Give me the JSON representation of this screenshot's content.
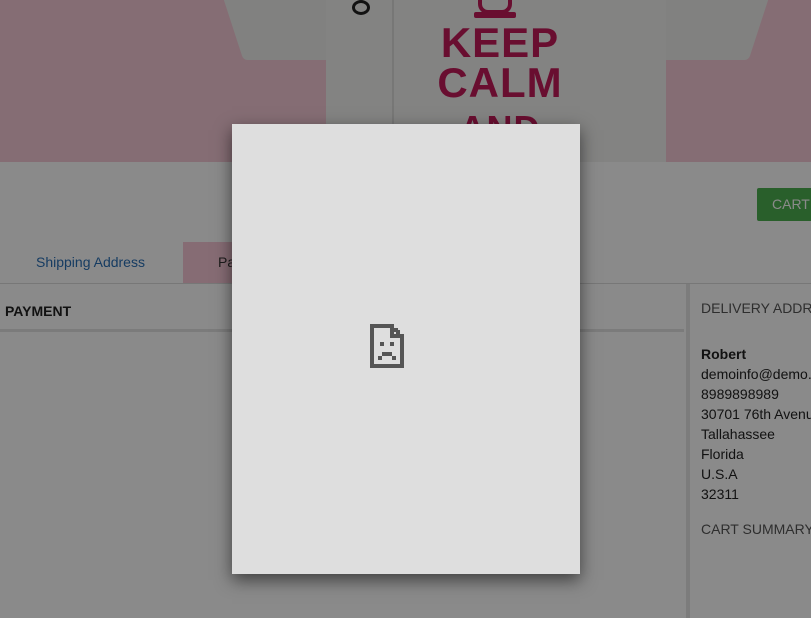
{
  "hero": {
    "shirt_text": [
      "KEEP",
      "CALM",
      "AND"
    ],
    "accent_color": "#c31a5a",
    "background_color": "#f6c9d6"
  },
  "header": {
    "cart_button_label": "CART"
  },
  "tabs": [
    {
      "label": "Shipping Address",
      "active": false
    },
    {
      "label": "Pa",
      "active": true
    }
  ],
  "payment": {
    "section_title": "PAYMENT"
  },
  "delivery": {
    "heading": "DELIVERY ADDR",
    "name": "Robert",
    "email": "demoinfo@demo.",
    "phone": "8989898989",
    "street": "30701 76th Avenu",
    "city": "Tallahassee",
    "state": "Florida",
    "country": "U.S.A",
    "zip": "32311"
  },
  "cart_summary": {
    "heading": "CART SUMMARY"
  },
  "dialog": {
    "icon": "broken-page-icon",
    "state": "frame-failed-to-load"
  },
  "colors": {
    "cart_button": "#4caf50",
    "tab_link": "#2a6fb6",
    "active_tab_bg": "#f8c7d6"
  }
}
